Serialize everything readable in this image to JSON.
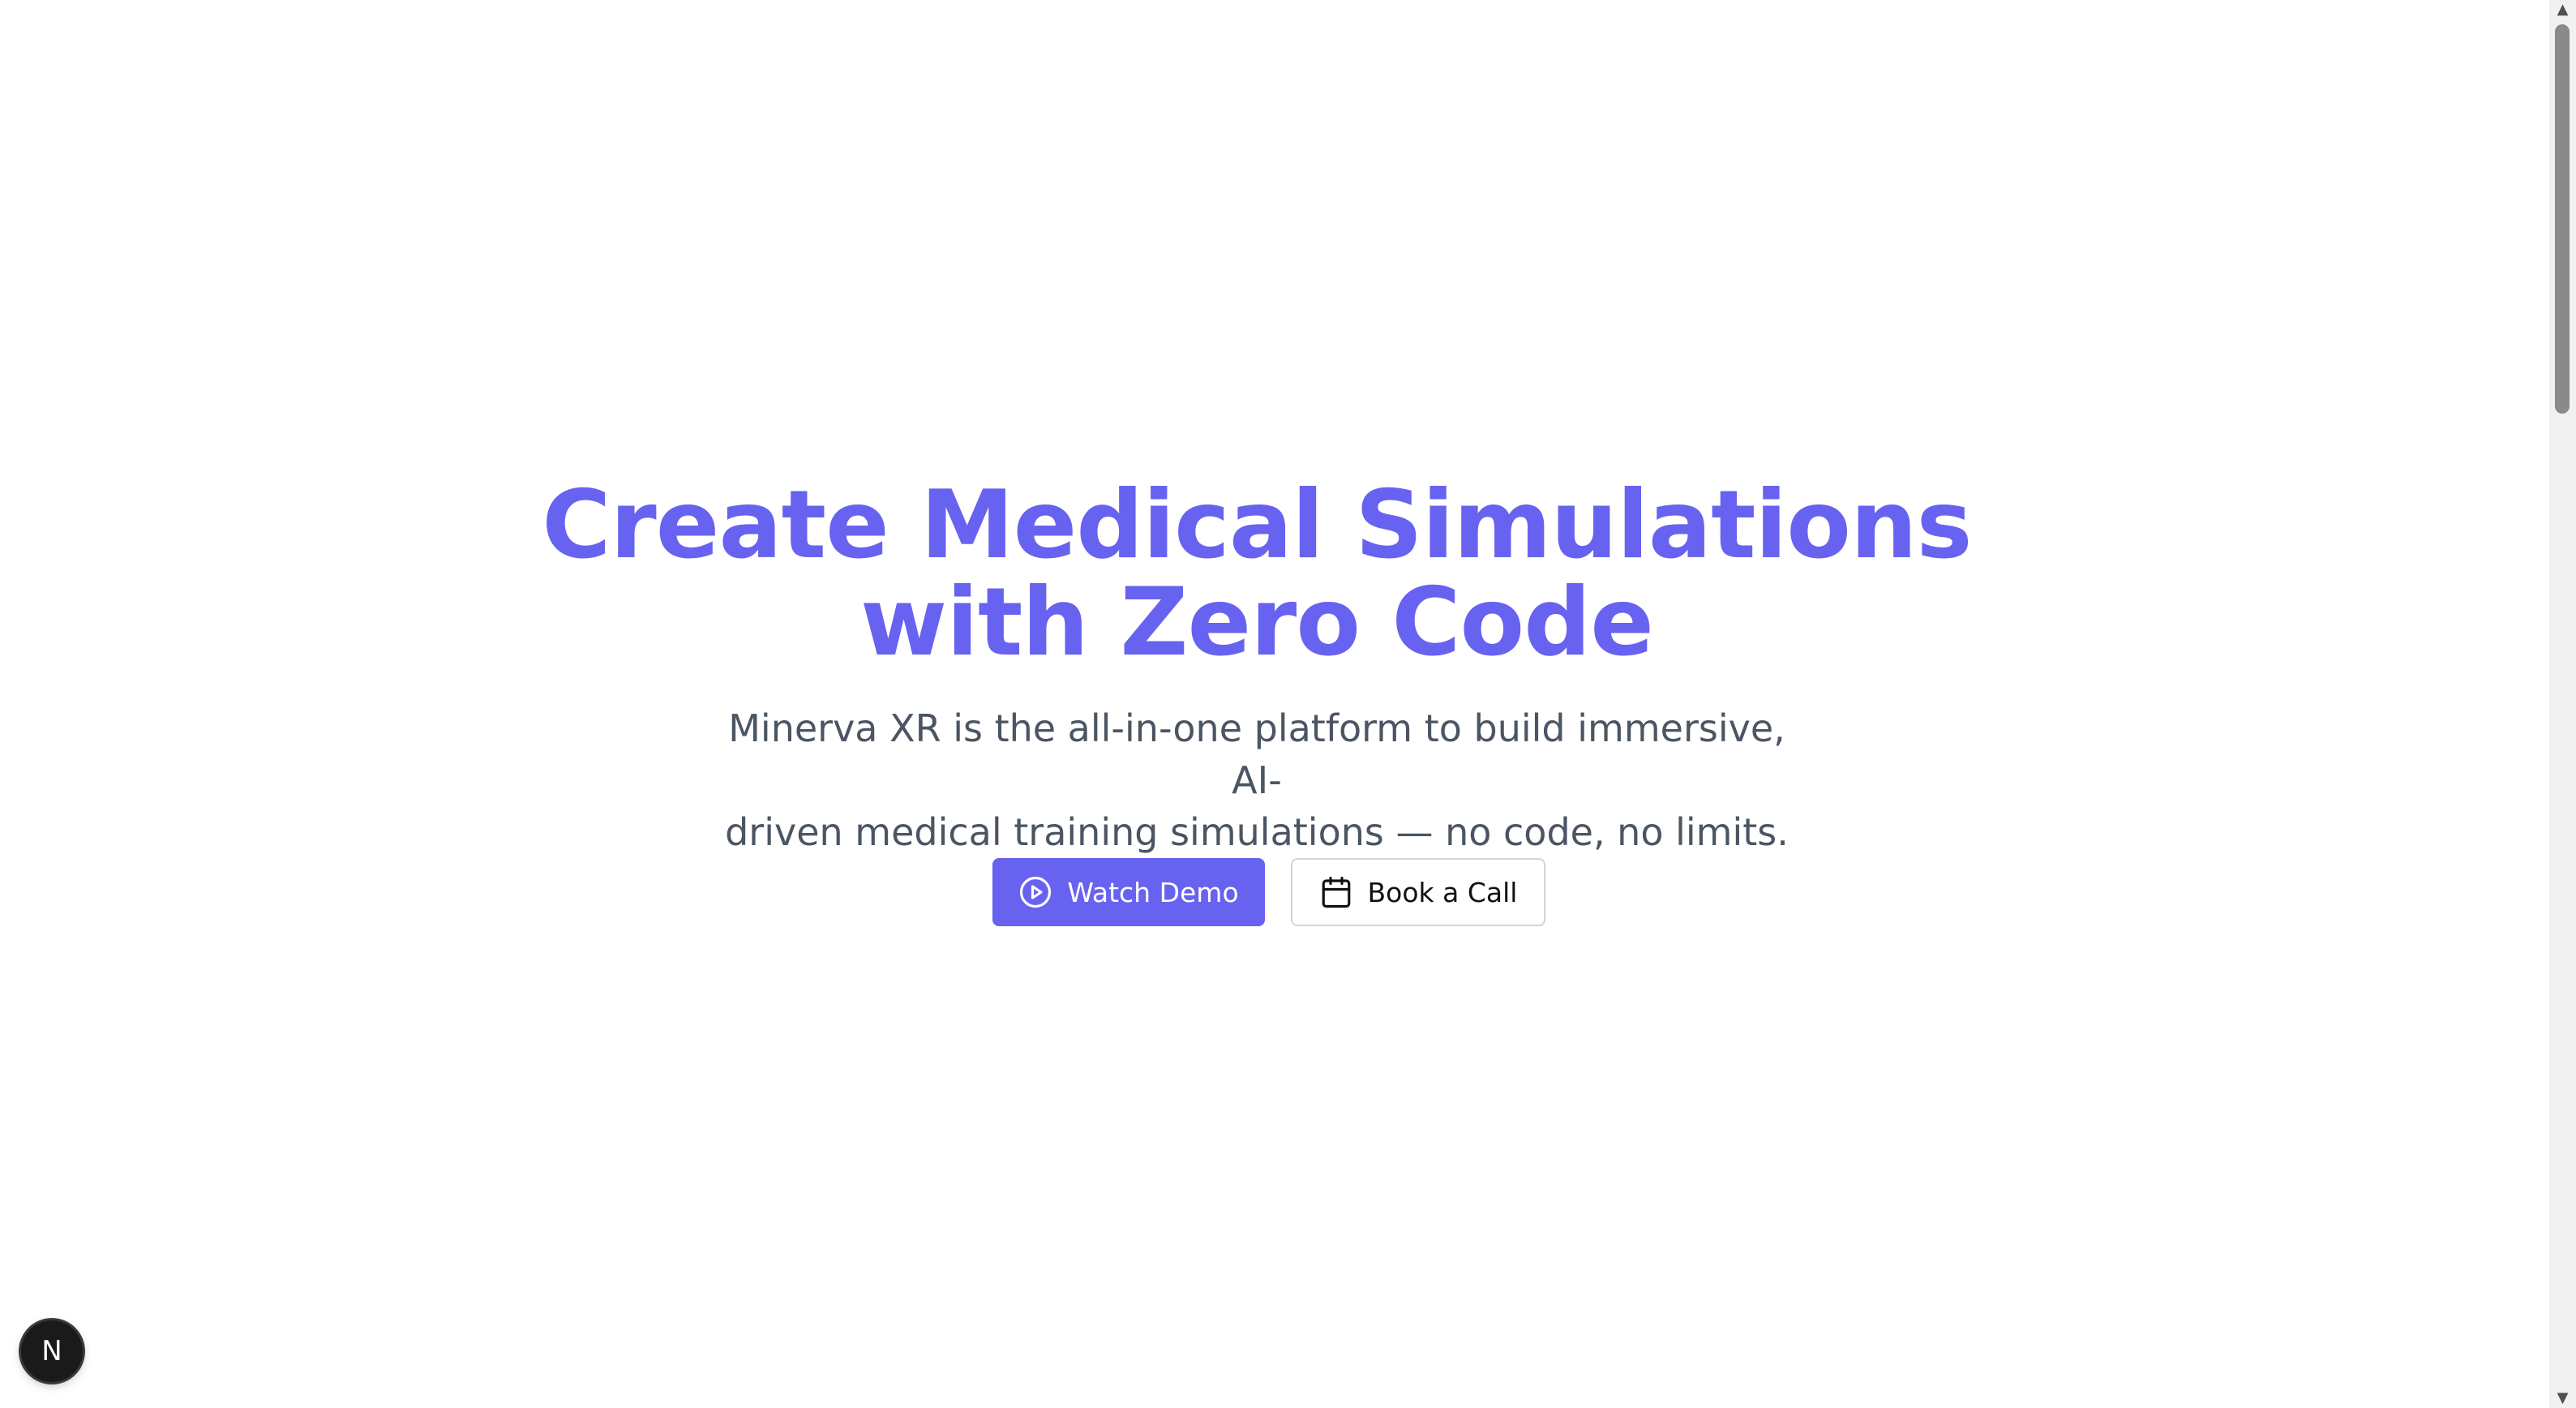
{
  "hero": {
    "title_line1": "Create Medical Simulations",
    "title_line2": "with Zero Code",
    "subtitle_line1": "Minerva XR is the all-in-one platform to build immersive, AI-",
    "subtitle_line2": "driven medical training simulations — no code, no limits.",
    "buttons": {
      "watch_demo": {
        "label": "Watch Demo",
        "icon": "play-circle-icon"
      },
      "book_call": {
        "label": "Book a Call",
        "icon": "calendar-icon"
      }
    }
  },
  "badge": {
    "label": "N",
    "icon": "nextjs-logo-icon"
  },
  "scrollbar": {
    "up_glyph": "▲",
    "down_glyph": "▼"
  },
  "colors": {
    "accent": "#6862f0",
    "subtitle_text": "#4b5563",
    "background": "#ffffff"
  }
}
